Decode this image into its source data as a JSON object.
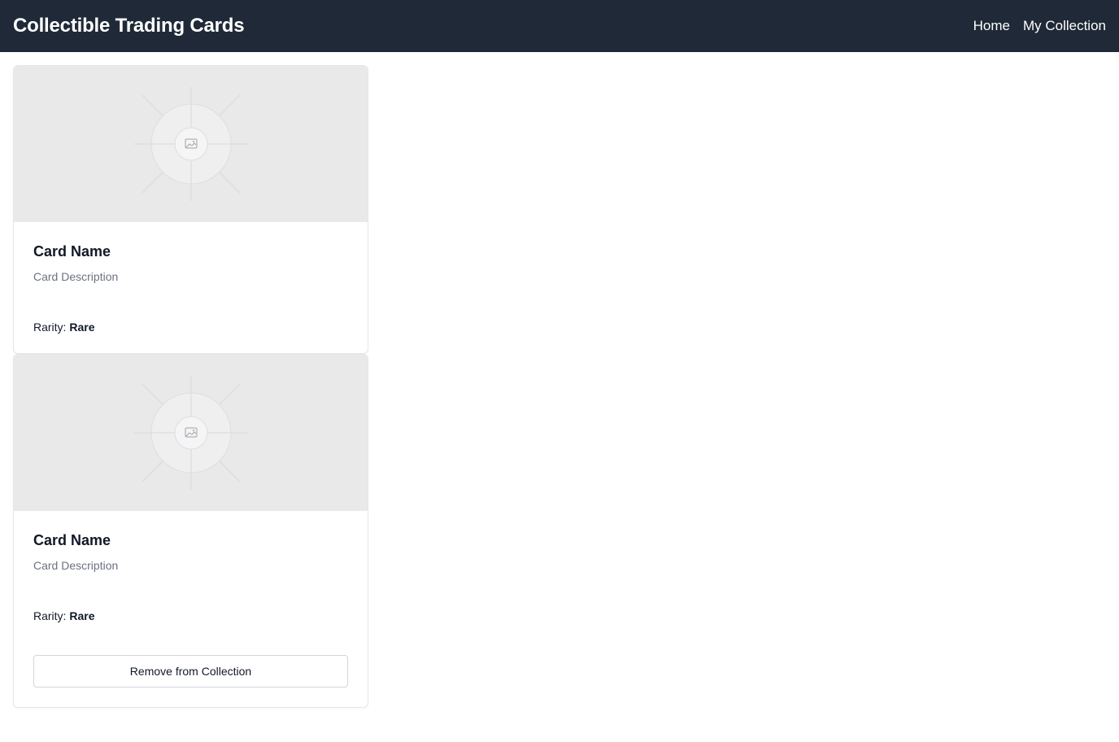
{
  "header": {
    "title": "Collectible Trading Cards",
    "nav": {
      "home": "Home",
      "collection": "My Collection"
    }
  },
  "cards": [
    {
      "name": "Card Name",
      "description": "Card Description",
      "rarity_label": "Rarity:",
      "rarity_value": "Rare",
      "image_icon": "image-placeholder-icon"
    },
    {
      "name": "Card Name",
      "description": "Card Description",
      "rarity_label": "Rarity:",
      "rarity_value": "Rare",
      "image_icon": "image-placeholder-icon",
      "button_label": "Remove from Collection"
    }
  ],
  "colors": {
    "header_bg": "#1f2937",
    "image_bg": "#e9e9e9",
    "muted_text": "#6b7280"
  }
}
